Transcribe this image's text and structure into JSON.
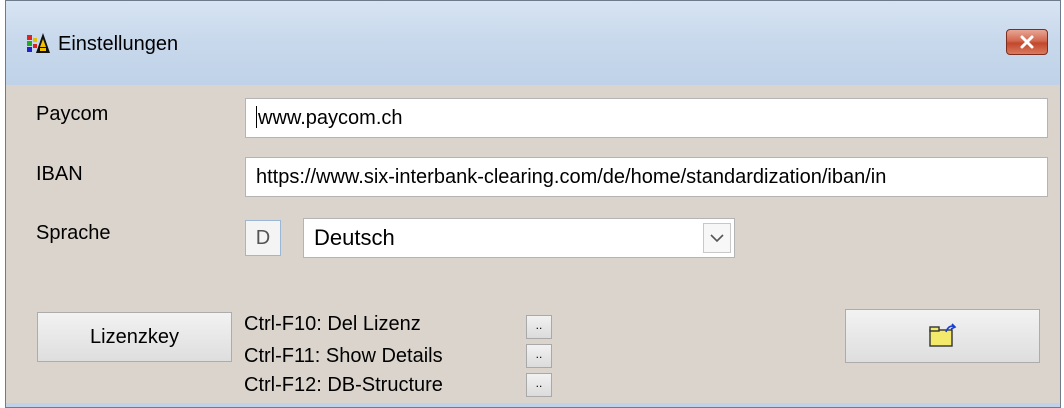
{
  "window": {
    "title": "Einstellungen",
    "icon": "app-icon",
    "close_icon": "close-icon"
  },
  "fields": {
    "paycom_label": "Paycom",
    "paycom_value": "www.paycom.ch",
    "iban_label": "IBAN",
    "iban_value": "https://www.six-interbank-clearing.com/de/home/standardization/iban/in",
    "sprache_label": "Sprache",
    "sprache_code": "D",
    "sprache_value": "Deutsch"
  },
  "buttons": {
    "lizenzkey_label": "Lizenzkey",
    "open_folder_icon": "open-folder-icon"
  },
  "shortcuts": [
    {
      "label": "Ctrl-F10: Del Lizenz",
      "button_label": ".."
    },
    {
      "label": "Ctrl-F11: Show Details",
      "button_label": ".."
    },
    {
      "label": "Ctrl-F12: DB-Structure",
      "button_label": ".."
    }
  ]
}
